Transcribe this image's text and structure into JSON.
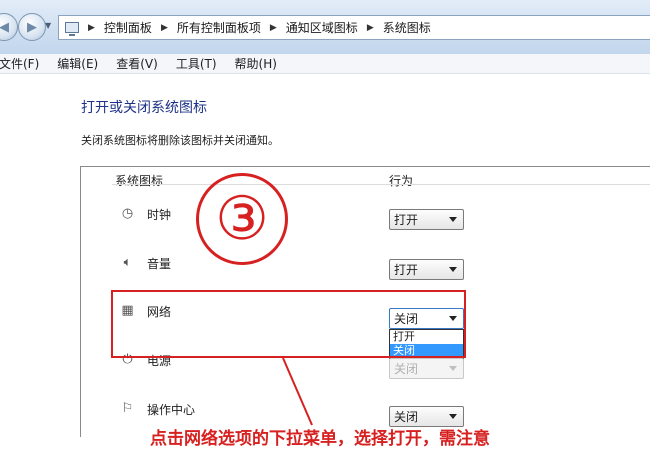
{
  "address": {
    "crumbs": [
      "控制面板",
      "所有控制面板项",
      "通知区域图标",
      "系统图标"
    ]
  },
  "menu": {
    "items": [
      "文件(F)",
      "编辑(E)",
      "查看(V)",
      "工具(T)",
      "帮助(H)"
    ]
  },
  "content": {
    "title": "打开或关闭系统图标",
    "description": "关闭系统图标将删除该图标并关闭通知。",
    "col_icon": "系统图标",
    "col_behavior": "行为",
    "rows": [
      {
        "icon": "clock-icon",
        "label": "时钟",
        "value": "打开"
      },
      {
        "icon": "volume-icon",
        "label": "音量",
        "value": "打开"
      },
      {
        "icon": "network-icon",
        "label": "网络",
        "value": "关闭"
      },
      {
        "icon": "power-icon",
        "label": "电源",
        "value": "关闭"
      },
      {
        "icon": "action-center-icon",
        "label": "操作中心",
        "value": "关闭"
      }
    ],
    "dropdown_options": [
      "打开",
      "关闭"
    ],
    "dropdown_selected": "关闭"
  },
  "annotation": {
    "step_number": "③",
    "text": "点击网络选项的下拉菜单，选择打开，需注意",
    "color": "#d72121"
  }
}
